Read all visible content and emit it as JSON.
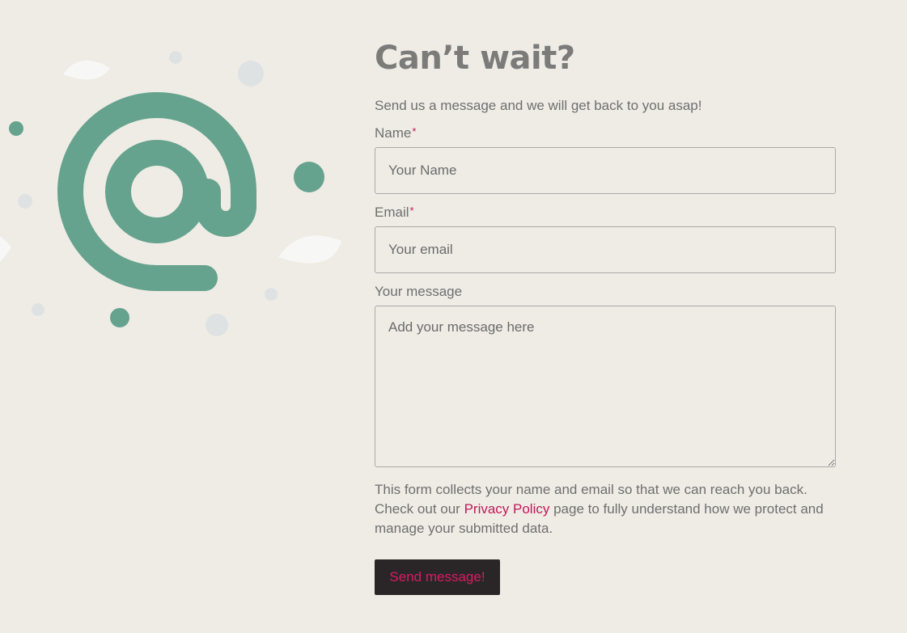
{
  "contact": {
    "title": "Can’t wait?",
    "intro": "Send us a message and we will get back to you asap!",
    "fields": {
      "name": {
        "label": "Name",
        "required_mark": "*",
        "placeholder": "Your Name"
      },
      "email": {
        "label": "Email",
        "required_mark": "*",
        "placeholder": "Your email"
      },
      "message": {
        "label": "Your message",
        "placeholder": "Add your message here"
      }
    },
    "notice": {
      "before": "This form collects your name and email so that we can reach you back. Check out our ",
      "link": "Privacy Policy",
      "after": " page to fully understand how we protect and manage your submitted data."
    },
    "submit_label": "Send message!"
  },
  "illustration": {
    "icon": "at-sign-icon",
    "accent_color": "#65a38e",
    "dot_color": "#dfe2e3",
    "leaf_color": "#f7f7f6"
  },
  "colors": {
    "background": "#efece5",
    "link": "#c2185b",
    "button_bg": "#2a2628",
    "button_text": "#d81b60"
  }
}
